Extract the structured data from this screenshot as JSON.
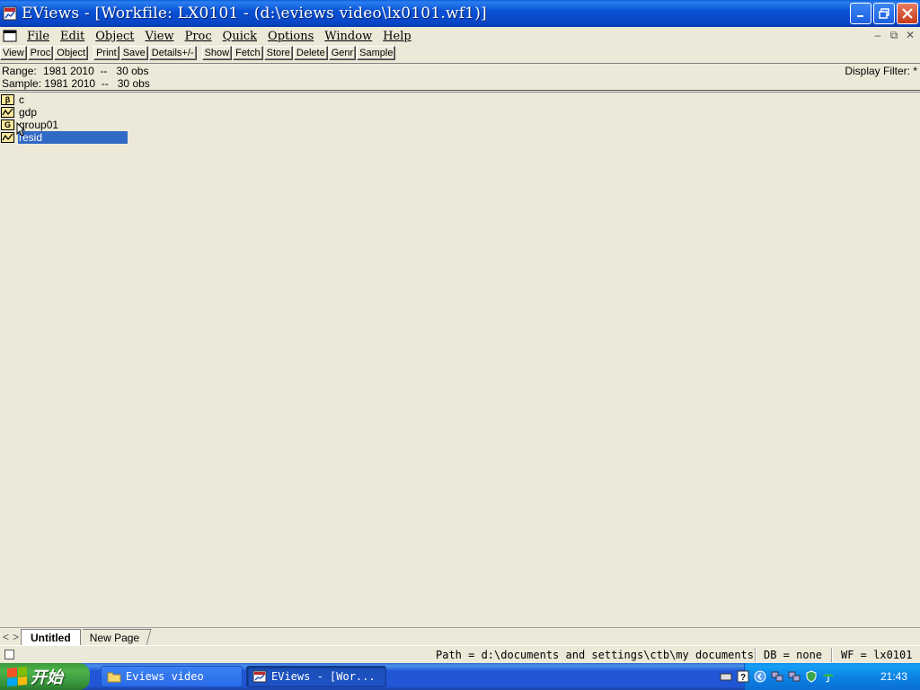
{
  "window": {
    "title": "EViews - [Workfile: LX0101 - (d:\\eviews video\\lx0101.wf1)]"
  },
  "menu": [
    "File",
    "Edit",
    "Object",
    "View",
    "Proc",
    "Quick",
    "Options",
    "Window",
    "Help"
  ],
  "toolbar": {
    "buttons": [
      "View",
      "Proc",
      "Object",
      "Print",
      "Save",
      "Details+/-",
      "Show",
      "Fetch",
      "Store",
      "Delete",
      "Genr",
      "Sample"
    ]
  },
  "info": {
    "range_label": "Range:",
    "range_value": "1981 2010  --   30 obs",
    "sample_label": "Sample:",
    "sample_value": "1981 2010  --   30 obs",
    "display_filter": "Display Filter: *"
  },
  "objects": [
    {
      "name": "c",
      "type": "coefficient",
      "icon_glyph": "β"
    },
    {
      "name": "gdp",
      "type": "series",
      "icon_glyph": "chart"
    },
    {
      "name": "group01",
      "type": "group",
      "icon_glyph": "G"
    },
    {
      "name": "resid",
      "type": "series",
      "icon_glyph": "chart",
      "selected": true
    }
  ],
  "page_tabs": {
    "nav_prev": "<",
    "nav_next": ">",
    "tabs": [
      "Untitled",
      "New Page"
    ],
    "active": "Untitled"
  },
  "status": {
    "path": "Path = d:\\documents and settings\\ctb\\my documents",
    "db": "DB = none",
    "wf": "WF = lx0101"
  },
  "taskbar": {
    "start_label": "开始",
    "tasks": [
      {
        "label": "Eviews video",
        "icon": "folder-icon",
        "active": false
      },
      {
        "label": "EViews - [Wor...",
        "icon": "eviews-icon",
        "active": true
      }
    ],
    "clock": "21:43"
  },
  "colors": {
    "title_blue": "#0a53d6",
    "selection": "#316ac5",
    "object_icon_fill": "#fbe89a",
    "start_green": "#4db34a",
    "taskbar_blue": "#2157d7"
  }
}
